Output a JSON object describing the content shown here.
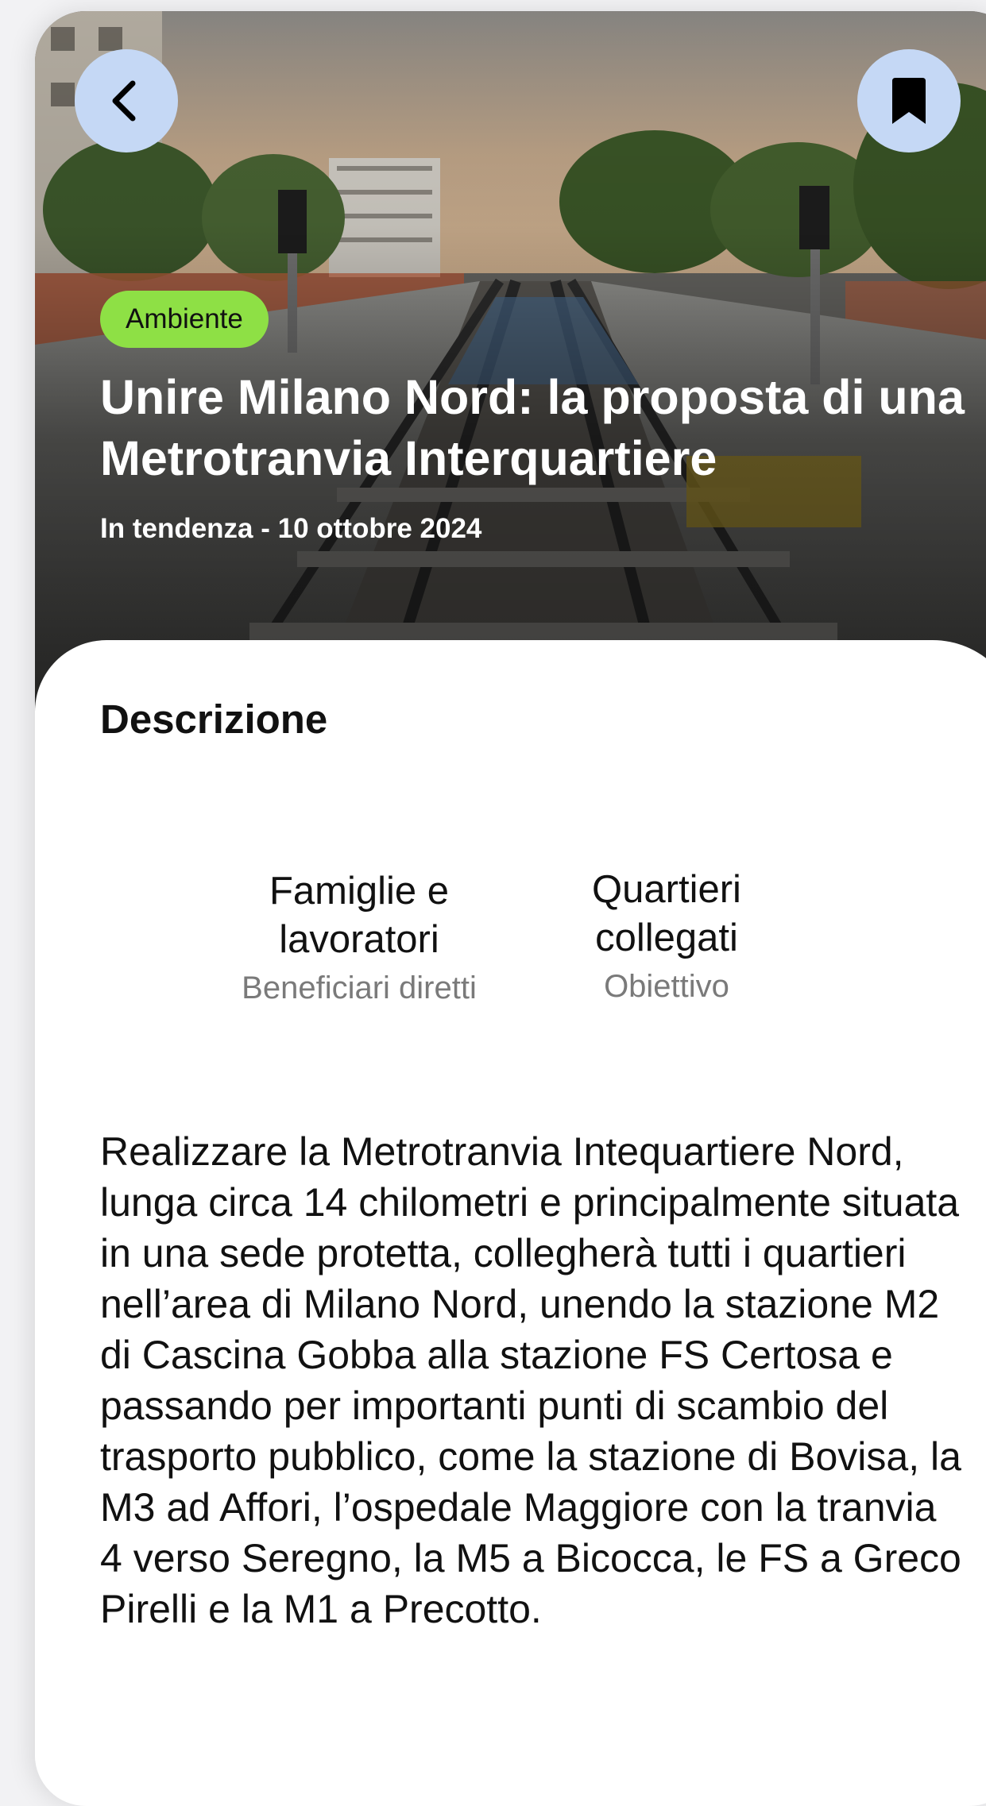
{
  "hero": {
    "category_badge": "Ambiente",
    "title": "Unire Milano Nord: la proposta di una Metrotranvia Interquartiere",
    "meta": "In tendenza - 10 ottobre 2024",
    "back_icon": "chevron-left-icon",
    "bookmark_icon": "bookmark-icon"
  },
  "description_section": {
    "heading": "Descrizione",
    "stats": [
      {
        "value": "Famiglie e lavoratori",
        "label": "Beneficiari diretti"
      },
      {
        "value": "Quartieri collegati",
        "label": "Obiettivo"
      }
    ],
    "body": "Realizzare la Metrotranvia Intequartiere Nord, lunga circa 14 chilometri e principalmente situata in una sede protetta, collegherà tutti i quartieri nell’area di Milano Nord, unendo la stazione M2 di Cascina Gobba alla stazione FS Certosa e passando per importanti punti di scambio del trasporto pubblico, come la stazione di Bovisa, la M3 ad Affori, l’ospedale Maggiore con la tranvia 4 verso Seregno, la M5 a Bicocca, le FS a Greco Pirelli e la M1 a Precotto."
  },
  "colors": {
    "badge": "#8ee045",
    "round_button": "#c5d8f5",
    "muted_text": "#7a7a7a"
  }
}
